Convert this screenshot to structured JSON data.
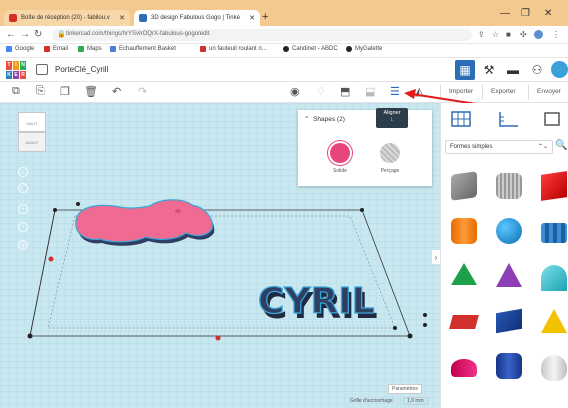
{
  "browser": {
    "tabs": [
      {
        "label": "Boîte de réception (20) - fabilou.v"
      },
      {
        "label": "3D design Fabulous Gogo | Tinke"
      }
    ],
    "new_tab": "+",
    "window_controls": [
      "—",
      "❐",
      "✕"
    ],
    "url": "tinkercad.com/things/hrYSvIrOQrX-fabulous-gogo/edit",
    "bookmarks": [
      "Google",
      "Email",
      "Maps",
      "Echauffement Basket",
      "un fauteuil roulant ri...",
      "Candinet - ABDC",
      "MyGalette"
    ]
  },
  "app": {
    "project_name": "PorteClé_Cyrill",
    "header_buttons": [
      "Importer",
      "Exporter",
      "Envoyer"
    ],
    "colors": {
      "accent": "#2d6db5",
      "tooltip": "#2b3d4b",
      "panel_header": "#f3c98f",
      "pink": "#e8457a",
      "shape_pink": "#f06b92",
      "text_navy": "#2f3e63",
      "workplane": "#c8e7ef"
    }
  },
  "viewcube": {
    "top": "HAUT",
    "front": "AVANT"
  },
  "nav_controls": [
    "⌂",
    "⤢",
    "+",
    "−",
    "◎"
  ],
  "shape_panel": {
    "title": "Shapes (2)",
    "solid": "Solide",
    "hole": "Perçage"
  },
  "tooltip": {
    "title": "Aligner",
    "key": "L"
  },
  "scene": {
    "text": "CYRIL"
  },
  "right_panel": {
    "category": "Formes simples"
  },
  "footer": {
    "params": "Paramètres",
    "snap_label": "Grille d'accrochage",
    "snap_value": "1,0 mm"
  }
}
